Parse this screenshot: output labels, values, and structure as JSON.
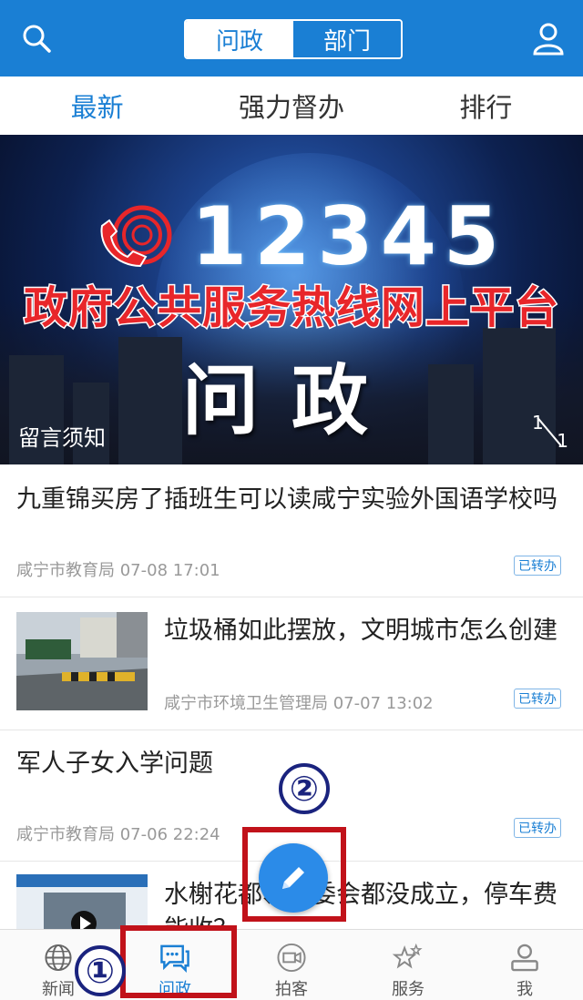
{
  "header": {
    "segments": [
      "问政",
      "部门"
    ],
    "active_segment": 0,
    "search_icon": "search-icon",
    "user_icon": "user-icon"
  },
  "subtabs": {
    "items": [
      "最新",
      "强力督办",
      "排行"
    ],
    "active": 0
  },
  "banner": {
    "hotline": "12345",
    "subtitle": "政府公共服务热线网上平台",
    "main": "问政",
    "caption": "留言须知",
    "pager_current": "1",
    "pager_total": "1"
  },
  "list": [
    {
      "title": "九重锦买房了插班生可以读咸宁实验外国语学校吗",
      "source": "咸宁市教育局 07-08 17:01",
      "status": "已转办",
      "has_thumb": false
    },
    {
      "title": "垃圾桶如此摆放，文明城市怎么创建",
      "source": "咸宁市环境卫生管理局 07-07 13:02",
      "status": "已转办",
      "has_thumb": true
    },
    {
      "title": "军人子女入学问题",
      "source": "咸宁市教育局 07-06 22:24",
      "status": "已转办",
      "has_thumb": false
    },
    {
      "title": "水榭花都、业委会都没成立，停车费能收？",
      "source": "",
      "status": "",
      "has_thumb": true
    }
  ],
  "annotations": {
    "marker_1": "①",
    "marker_2": "②",
    "highlight_color": "#c1121a"
  },
  "fab": {
    "icon": "pencil-icon"
  },
  "bottomnav": {
    "items": [
      {
        "label": "新闻",
        "icon": "globe-icon"
      },
      {
        "label": "问政",
        "icon": "chat-icon"
      },
      {
        "label": "拍客",
        "icon": "camera-icon"
      },
      {
        "label": "服务",
        "icon": "stars-icon"
      },
      {
        "label": "我",
        "icon": "user-icon"
      }
    ],
    "active": 1
  },
  "colors": {
    "primary": "#1a7fd4",
    "annotation_red": "#c1121a",
    "annotation_navy": "#1a237e"
  }
}
